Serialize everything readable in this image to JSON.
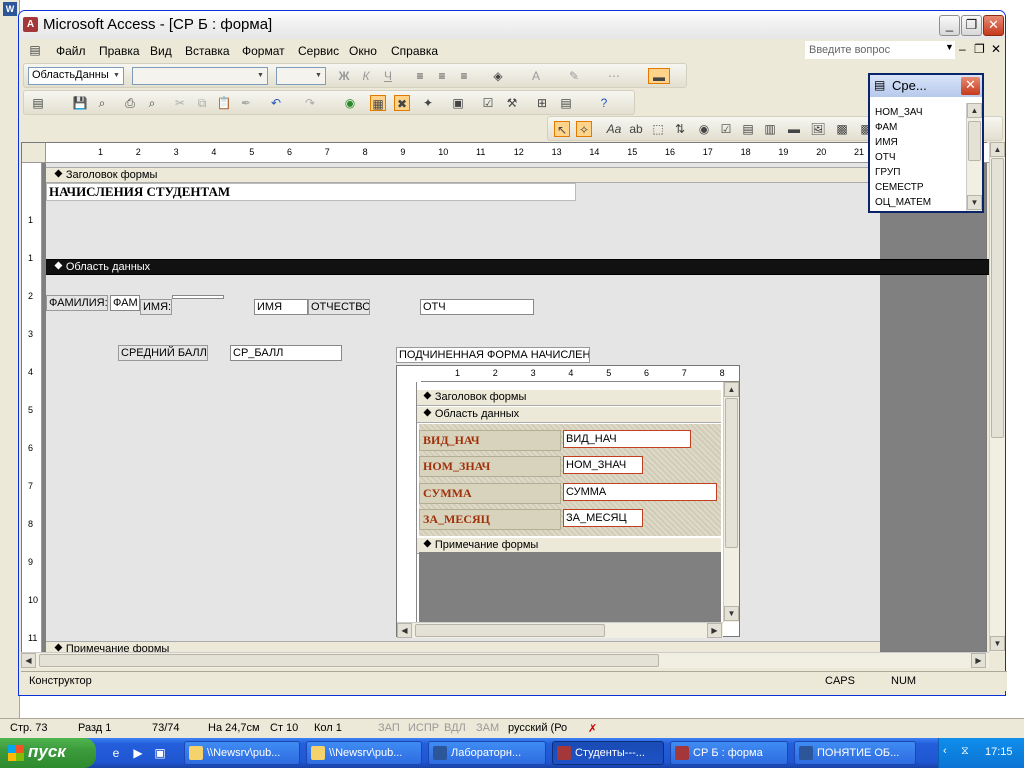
{
  "window": {
    "title": "Microsoft Access - [СР Б : форма]"
  },
  "menu": {
    "items": [
      "Файл",
      "Правка",
      "Вид",
      "Вставка",
      "Формат",
      "Сервис",
      "Окно",
      "Справка"
    ],
    "question_placeholder": "Введите вопрос"
  },
  "toolbar": {
    "object_combo": "ОбластьДанны",
    "bold": "Ж",
    "italic": "К",
    "underline": "Ч"
  },
  "rulers": {
    "h": [
      "1",
      "2",
      "3",
      "4",
      "5",
      "6",
      "7",
      "8",
      "9",
      "10",
      "11",
      "12",
      "13",
      "14",
      "15",
      "16",
      "17",
      "18",
      "19",
      "20",
      "21",
      "22"
    ],
    "v": [
      "1",
      "1",
      "2",
      "3",
      "4",
      "5",
      "6",
      "7",
      "8",
      "9",
      "10",
      "11"
    ],
    "sub_h": [
      "1",
      "2",
      "3",
      "4",
      "5",
      "6",
      "7",
      "8"
    ]
  },
  "form": {
    "header_section": "Заголовок формы",
    "title": "НАЧИСЛЕНИЯ СТУДЕНТАМ",
    "detail_section": "Область данных",
    "footer_section": "Примечание формы",
    "fields": {
      "lastname_label": "ФАМИЛИЯ:",
      "lastname_value": "ФАМ",
      "firstname_label": "ИМЯ:",
      "firstname_value": "ИМЯ",
      "patronymic_label": "ОТЧЕСТВО:",
      "patronymic_value": "ОТЧ",
      "avg_label": "СРЕДНИЙ БАЛЛ",
      "avg_value": "СР_БАЛЛ"
    },
    "subform": {
      "label": "ПОДЧИНЕННАЯ ФОРМА НАЧИСЛЕНИЯ",
      "header_section": "Заголовок формы",
      "detail_section": "Область данных",
      "footer_section": "Примечание формы",
      "rows": [
        {
          "label": "ВИД_НАЧ",
          "value": "ВИД_НАЧ"
        },
        {
          "label": "НОМ_ЗНАЧ",
          "value": "НОМ_ЗНАЧ"
        },
        {
          "label": "СУММА",
          "value": "СУММА"
        },
        {
          "label": "ЗА_МЕСЯЦ",
          "value": "ЗА_МЕСЯЦ"
        }
      ]
    }
  },
  "field_list": {
    "title": "Сре...",
    "items": [
      "НОМ_ЗАЧ",
      "ФАМ",
      "ИМЯ",
      "ОТЧ",
      "ГРУП",
      "СЕМЕСТР",
      "ОЦ_МАТЕМ"
    ]
  },
  "status": {
    "mode": "Конструктор",
    "caps": "CAPS",
    "num": "NUM"
  },
  "word_status": {
    "page": "Стр. 73",
    "section": "Разд 1",
    "pages": "73/74",
    "at": "На 24,7см",
    "line": "Ст 10",
    "col": "Кол 1",
    "rec": "ЗАП",
    "trk": "ИСПР",
    "ext": "ВДЛ",
    "ovr": "ЗАМ",
    "lang": "русский (Ро"
  },
  "taskbar": {
    "start": "пуск",
    "tasks": [
      "\\\\Newsrv\\pub...",
      "\\\\Newsrv\\pub...",
      "Лабораторн...",
      "Студенты---...",
      "СР Б : форма",
      "ПОНЯТИЕ ОБ..."
    ],
    "clock": "17:15"
  }
}
